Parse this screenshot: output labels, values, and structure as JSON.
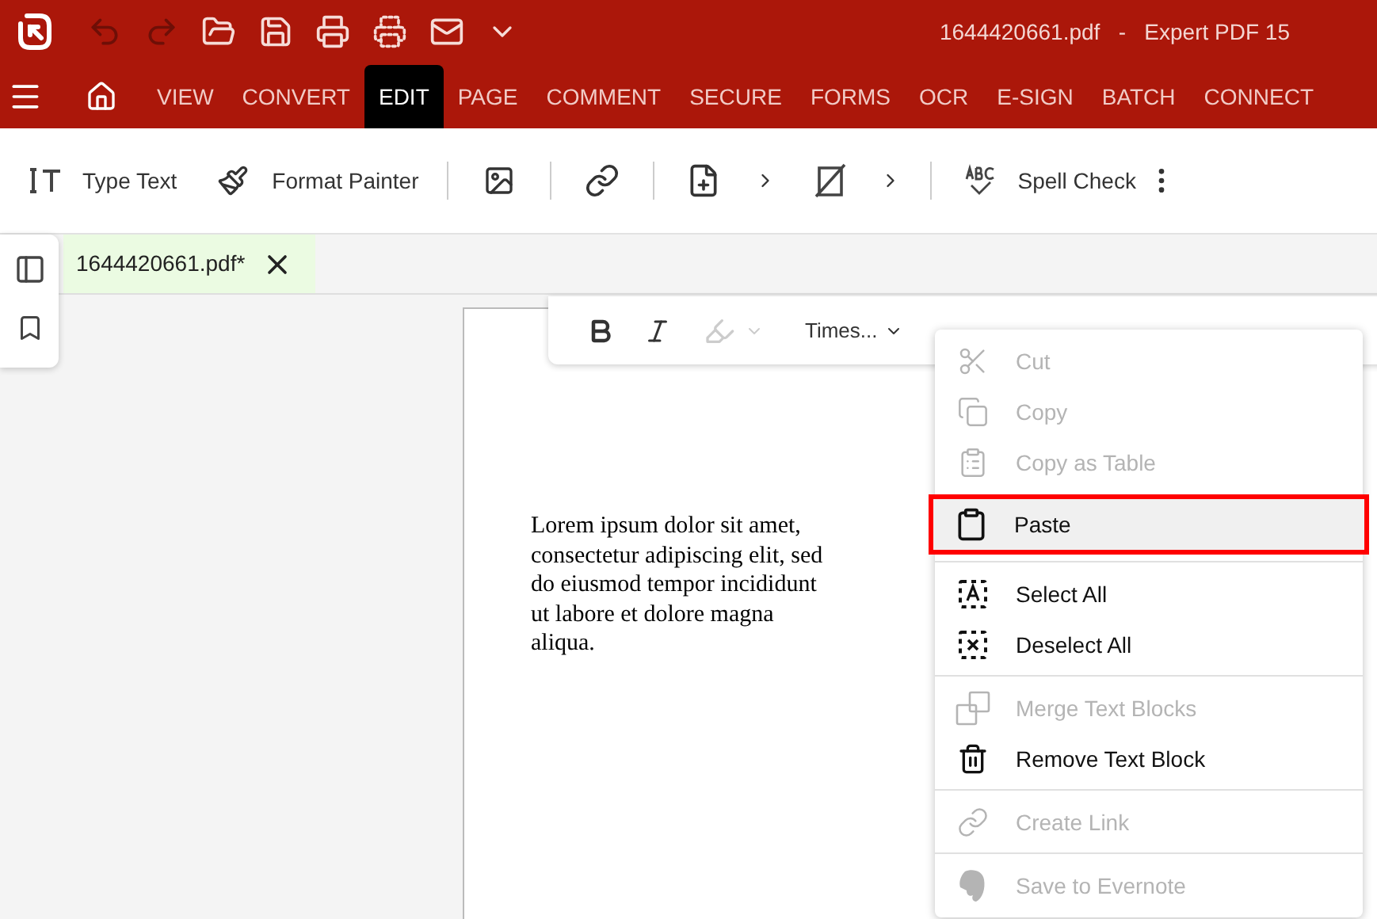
{
  "window": {
    "title": "1644420661.pdf   -   Expert PDF 15"
  },
  "ribbon_tabs": [
    {
      "label": "VIEW",
      "selected": false
    },
    {
      "label": "CONVERT",
      "selected": false
    },
    {
      "label": "EDIT",
      "selected": true
    },
    {
      "label": "PAGE",
      "selected": false
    },
    {
      "label": "COMMENT",
      "selected": false
    },
    {
      "label": "SECURE",
      "selected": false
    },
    {
      "label": "FORMS",
      "selected": false
    },
    {
      "label": "OCR",
      "selected": false
    },
    {
      "label": "E-SIGN",
      "selected": false
    },
    {
      "label": "BATCH",
      "selected": false
    },
    {
      "label": "CONNECT",
      "selected": false
    }
  ],
  "toolbar": {
    "type_text": "Type Text",
    "format_painter": "Format Painter",
    "spell_check": "Spell Check"
  },
  "document_tab": {
    "label": "1644420661.pdf*",
    "selected": true
  },
  "format_bar": {
    "font": "Times..."
  },
  "page_text": "Lorem ipsum dolor sit amet, consectetur adipiscing elit, sed do eiusmod tempor incididunt ut labore et dolore magna aliqua.",
  "context_menu": [
    [
      {
        "label": "Cut",
        "disabled": true,
        "selected": false
      },
      {
        "label": "Copy",
        "disabled": true,
        "selected": false
      },
      {
        "label": "Copy as Table",
        "disabled": true,
        "selected": false
      },
      {
        "label": "Paste",
        "disabled": false,
        "selected": true
      }
    ],
    [
      {
        "label": "Select All",
        "disabled": false,
        "selected": false
      },
      {
        "label": "Deselect All",
        "disabled": false,
        "selected": false
      }
    ],
    [
      {
        "label": "Merge Text Blocks",
        "disabled": true,
        "selected": false
      },
      {
        "label": "Remove Text Block",
        "disabled": false,
        "selected": false
      }
    ],
    [
      {
        "label": "Create Link",
        "disabled": true,
        "selected": false
      }
    ],
    [
      {
        "label": "Save to Evernote",
        "disabled": true,
        "selected": false
      }
    ]
  ]
}
